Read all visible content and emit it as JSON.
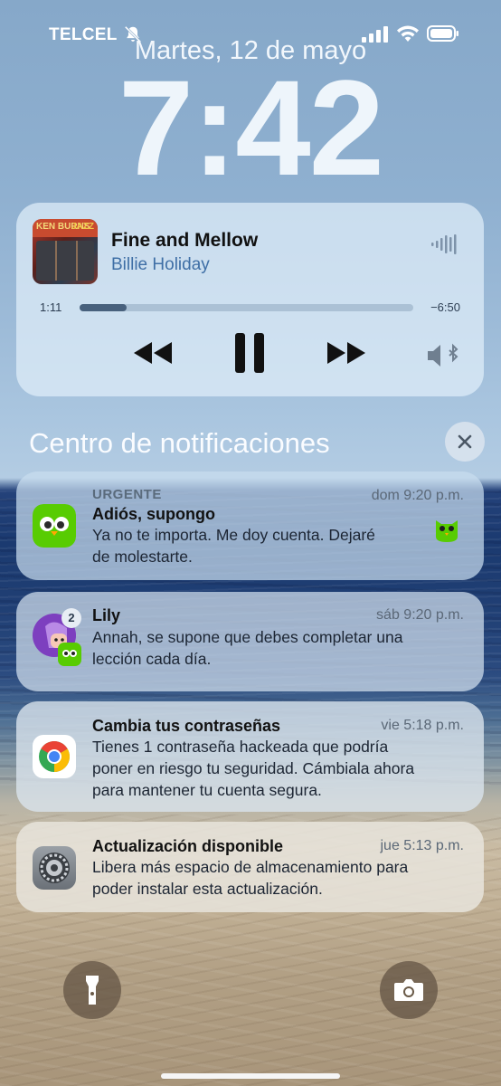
{
  "status_bar": {
    "carrier": "TELCEL",
    "icons": [
      "bell-slash-icon",
      "signal-icon",
      "wifi-icon",
      "battery-icon"
    ]
  },
  "lockscreen": {
    "date": "Martes, 12 de mayo",
    "time": "7:42"
  },
  "now_playing": {
    "album_art_text": [
      "KEN BURNS",
      "JAZZ"
    ],
    "title": "Fine and Mellow",
    "artist": "Billie Holiday",
    "elapsed": "1:11",
    "remaining": "−6:50",
    "progress": 0.14,
    "controls": [
      "rewind-icon",
      "pause-icon",
      "fast-forward-icon",
      "bluetooth-speaker-icon"
    ]
  },
  "notification_center": {
    "title": "Centro de notificaciones",
    "close_icon": "close-icon"
  },
  "notifications": [
    {
      "app": "Duolingo",
      "tag": "URGENTE",
      "title": "Adiós, supongo",
      "time": "dom 9:20 p.m.",
      "body_lines": [
        "Ya no te importa. Me doy cuenta. Dejaré",
        "de molestarte."
      ]
    },
    {
      "app": "Duolingo",
      "title": "Lily",
      "time": "sáb 9:20 p.m.",
      "badge": "2",
      "body_lines": [
        "Annah, se supone que debes completar una",
        "lección cada día."
      ]
    },
    {
      "app": "Chrome",
      "title": "Cambia tus contraseñas",
      "time": "vie 5:18 p.m.",
      "body_lines": [
        "Tienes 1 contraseña hackeada que podría",
        "poner en riesgo tu seguridad. Cámbiala ahora",
        "para mantener tu cuenta segura."
      ]
    },
    {
      "app": "Ajustes",
      "title": "Actualización disponible",
      "time": "jue 5:13 p.m.",
      "body_lines": [
        "Libera más espacio de almacenamiento para",
        "poder instalar esta actualización."
      ]
    }
  ],
  "bottom_controls": [
    "flashlight-icon",
    "camera-icon"
  ],
  "colors": {
    "duolingo_green": "#58cc02",
    "artist_blue": "#3f6fa6",
    "chrome_red": "#ea4335",
    "chrome_yellow": "#fbbc05",
    "chrome_green": "#34a853",
    "chrome_blue": "#4285f4"
  }
}
